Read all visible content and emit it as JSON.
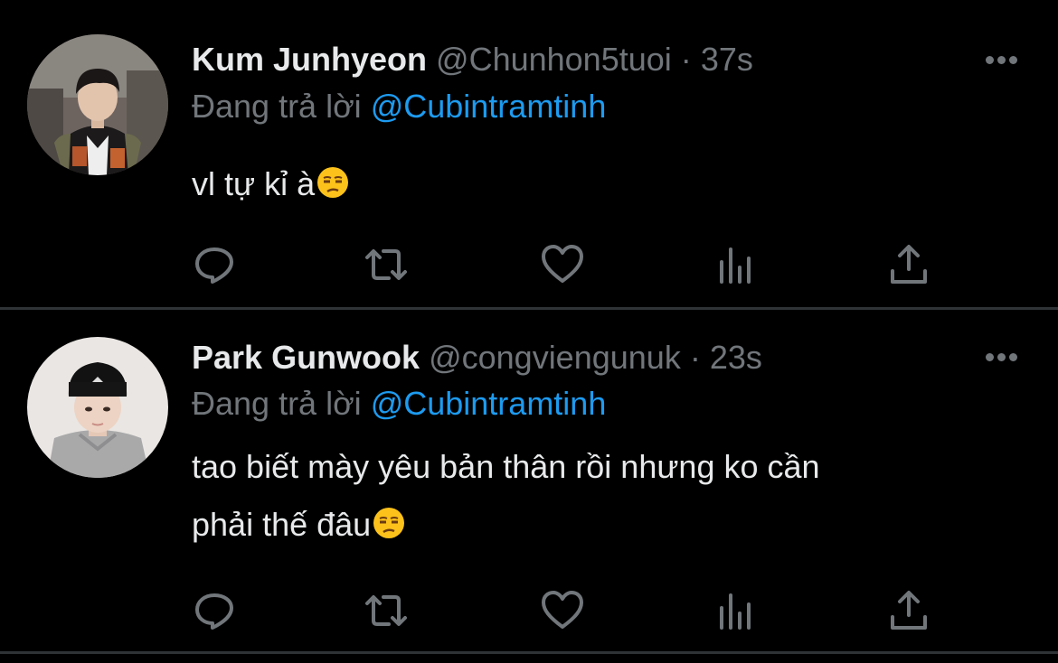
{
  "tweets": [
    {
      "name": "Kum Junhyeon",
      "handle": "@Chunhon5tuoi",
      "separator": "·",
      "time": "37s",
      "replying_prefix": "Đang trả lời",
      "replying_to": "@Cubintramtinh",
      "text": "vl tự kỉ à",
      "emoji": "unamused-face"
    },
    {
      "name": "Park Gunwook",
      "handle": "@congviengunuk",
      "separator": "·",
      "time": "23s",
      "replying_prefix": "Đang trả lời",
      "replying_to": "@Cubintramtinh",
      "text_line1": "tao biết mày yêu bản thân rồi nhưng ko cần",
      "text_line2": "phải thế đâu",
      "emoji": "unamused-face"
    }
  ],
  "action_icons": [
    "reply-icon",
    "retweet-icon",
    "like-icon",
    "analytics-icon",
    "share-icon"
  ],
  "colors": {
    "background": "#000000",
    "primary_text": "#e7e9ea",
    "secondary_text": "#71767b",
    "accent": "#1d9bf0",
    "divider": "#2f3336"
  }
}
